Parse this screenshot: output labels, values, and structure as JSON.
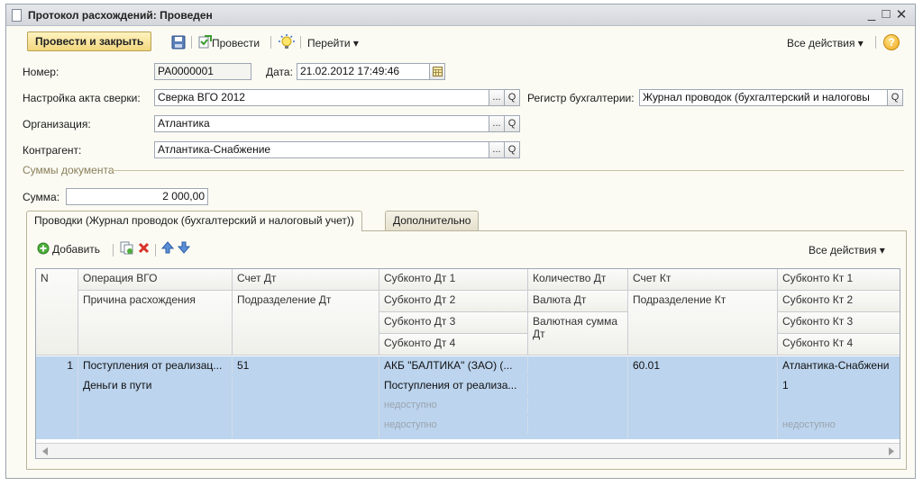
{
  "window": {
    "title": "Протокол расхождений: Проведен",
    "controls": {
      "minimize": "_",
      "maximize": "□",
      "close": "✕"
    }
  },
  "toolbar": {
    "post_and_close": "Провести и закрыть",
    "post": "Провести",
    "goto": "Перейти ▾",
    "all_actions": "Все действия ▾",
    "help": "?"
  },
  "form": {
    "number_label": "Номер:",
    "number_value": "РА0000001",
    "date_label": "Дата:",
    "date_value": "21.02.2012 17:49:46",
    "setting_label": "Настройка акта сверки:",
    "setting_value": "Сверка ВГО 2012",
    "register_label": "Регистр бухгалтерии:",
    "register_value": "Журнал проводок (бухгалтерский и налоговы",
    "org_label": "Организация:",
    "org_value": "Атлантика",
    "contractor_label": "Контрагент:",
    "contractor_value": "Атлантика-Снабжение",
    "select_btn": "...",
    "search_btn": "Q"
  },
  "sums": {
    "section_title": "Суммы документа",
    "sum_label": "Сумма:",
    "sum_value": "2 000,00"
  },
  "tabs": [
    {
      "label": "Проводки (Журнал проводок (бухгалтерский и налоговый учет))",
      "active": true
    },
    {
      "label": "Дополнительно",
      "active": false
    }
  ],
  "table_toolbar": {
    "add": "Добавить",
    "all_actions": "Все действия ▾"
  },
  "table": {
    "headers": {
      "n": "N",
      "op": "Операция ВГО",
      "reason": "Причина расхождения",
      "acc_dt": "Счет Дт",
      "div_dt": "Подразделение Дт",
      "sub_dt1": "Субконто Дт 1",
      "sub_dt2": "Субконто Дт 2",
      "sub_dt3": "Субконто Дт 3",
      "sub_dt4": "Субконто Дт 4",
      "qty_dt": "Количество Дт",
      "cur_dt": "Валюта Дт",
      "cursum_dt": "Валютная сумма Дт",
      "acc_kt": "Счет Кт",
      "div_kt": "Подразделение Кт",
      "sub_kt1": "Субконто Кт 1",
      "sub_kt2": "Субконто Кт 2",
      "sub_kt3": "Субконто Кт 3",
      "sub_kt4": "Субконто Кт 4"
    },
    "rows": [
      {
        "n": "1",
        "op": "Поступления от реализац...",
        "reason": "Деньги в пути",
        "acc_dt": "51",
        "sub_dt1": "АКБ \"БАЛТИКА\" (ЗАО) (...",
        "sub_dt2": "Поступления от реализа...",
        "sub_dt3": "недоступно",
        "sub_dt4": "недоступно",
        "acc_kt": "60.01",
        "sub_kt1": "Атлантика-Снабжени",
        "sub_kt2": "1",
        "sub_kt4": "недоступно"
      }
    ]
  },
  "colors": {
    "selected_row": "#bcd4ee",
    "primary_button": "#f3d77e",
    "form_bg": "#fbfbf4"
  }
}
